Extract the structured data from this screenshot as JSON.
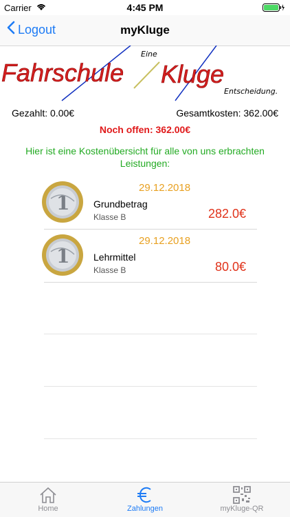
{
  "status": {
    "carrier": "Carrier",
    "time": "4:45 PM"
  },
  "nav": {
    "back_label": "Logout",
    "title": "myKluge"
  },
  "logo": {
    "part1": "Fahrschule",
    "part2": "Kluge",
    "tag1": "Eine",
    "tag2": "Entscheidung."
  },
  "summary": {
    "paid": "Gezahlt: 0.00€",
    "total": "Gesamtkosten: 362.00€",
    "open": "Noch offen: 362.00€",
    "intro": "Hier ist eine Kostenübersicht für alle von uns erbrachten Leistungen:"
  },
  "items": [
    {
      "date": "29.12.2018",
      "title": "Grundbetrag",
      "class": "Klasse B",
      "amount": "282.0€"
    },
    {
      "date": "29.12.2018",
      "title": "Lehrmittel",
      "class": "Klasse B",
      "amount": "80.0€"
    }
  ],
  "tabs": [
    {
      "label": "Home",
      "icon": "home-icon"
    },
    {
      "label": "Zahlungen",
      "icon": "euro-icon"
    },
    {
      "label": "myKluge-QR",
      "icon": "qr-code-icon"
    }
  ],
  "colors": {
    "accent": "#1d7bf5",
    "open": "#e0191a",
    "intro": "#22aa22",
    "date": "#e8a020"
  }
}
